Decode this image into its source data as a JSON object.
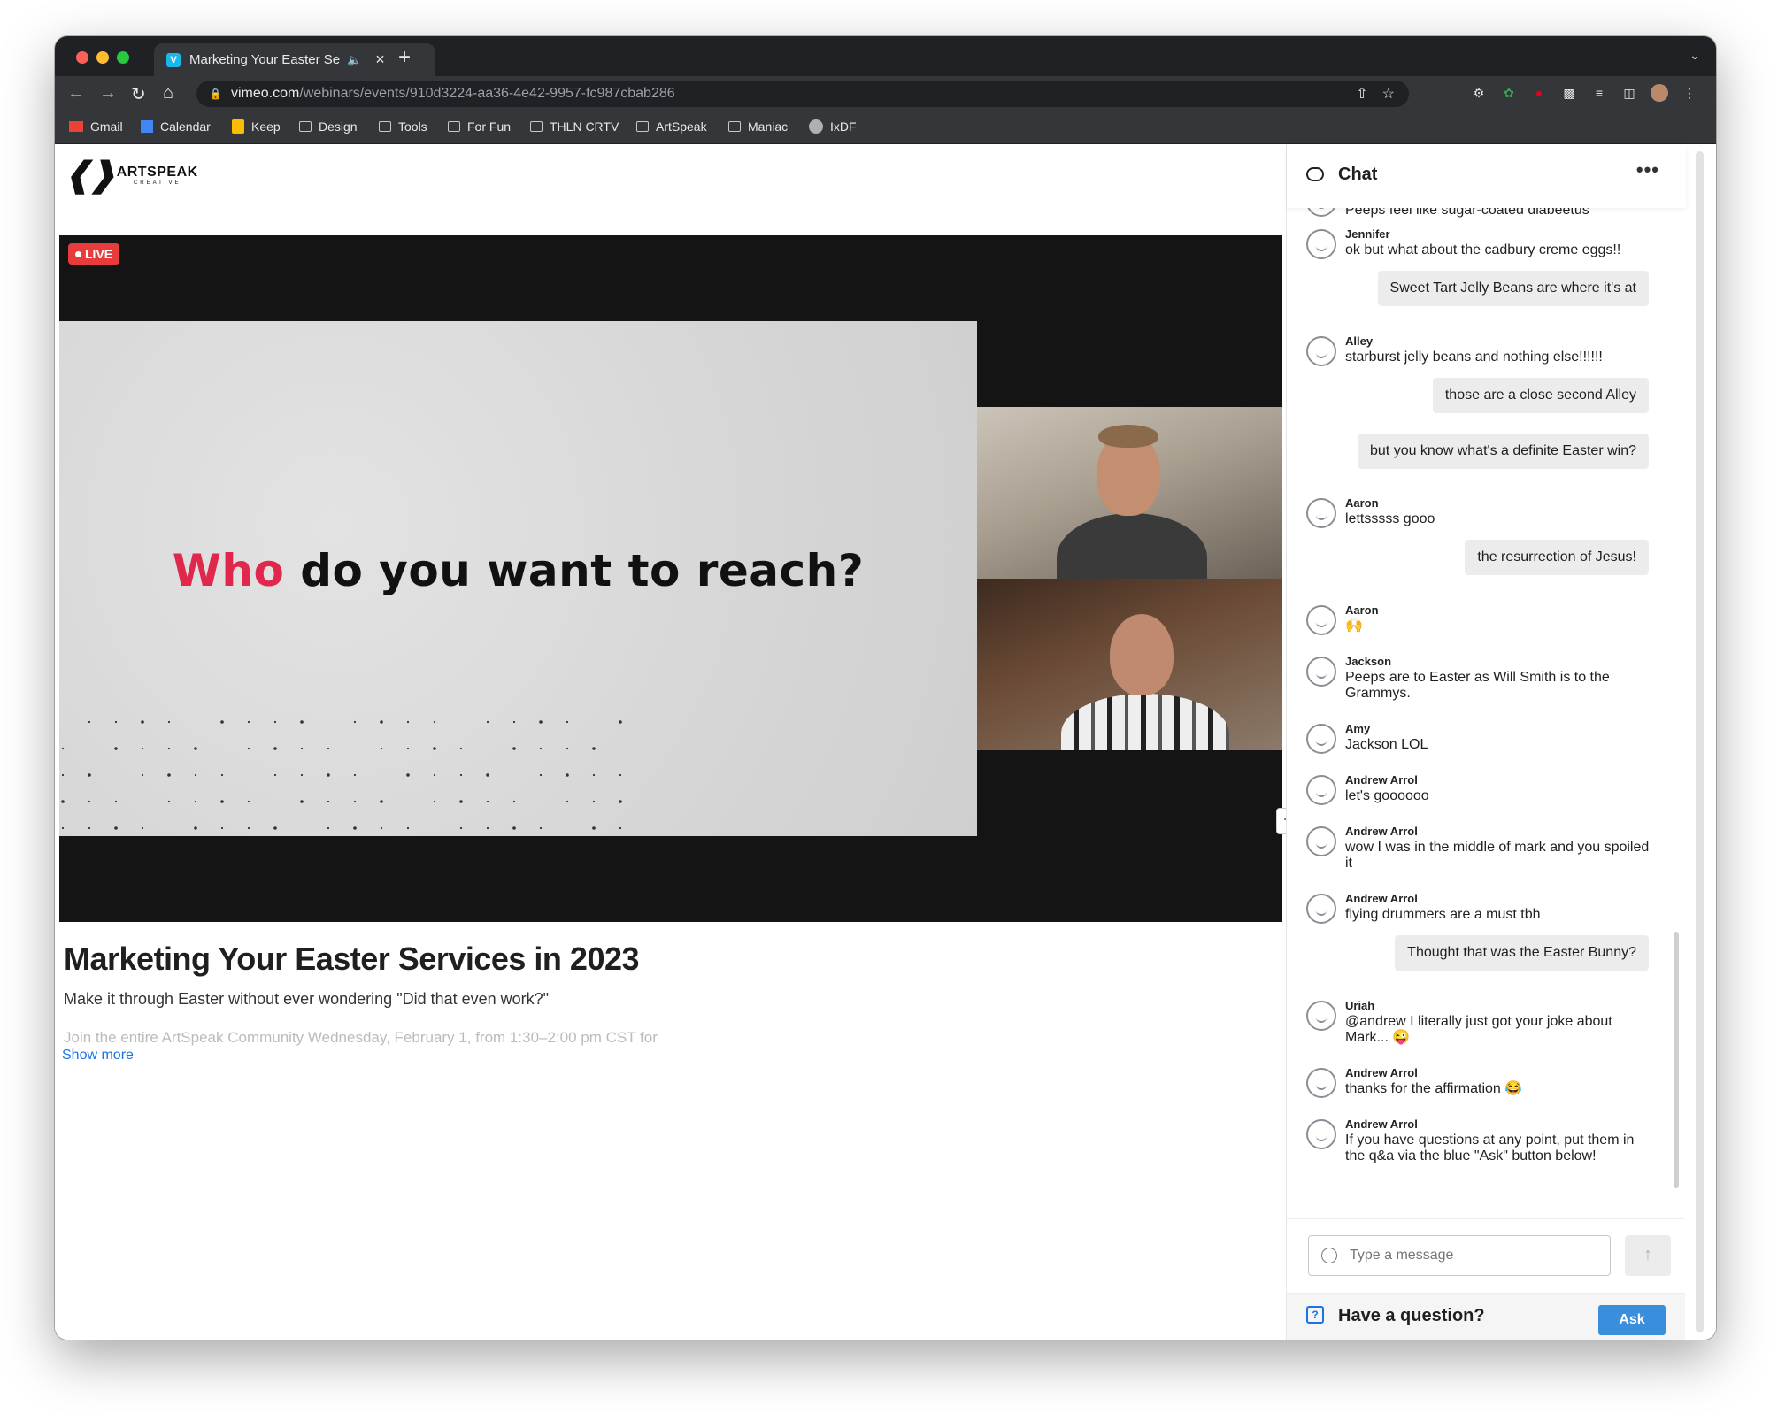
{
  "browser": {
    "tab_title": "Marketing Your Easter Ser…",
    "tab_favicon": "V",
    "tab_audio_icon": "speaker-muted-icon",
    "new_tab_icon": "+",
    "url_host": "vimeo.com",
    "url_path": "/webinars/events/910d3224-aa36-4e42-9957-fc987cbab286",
    "bookmarks": [
      {
        "label": "Gmail",
        "icon": "gmail-icon"
      },
      {
        "label": "Calendar",
        "icon": "calendar-icon"
      },
      {
        "label": "Keep",
        "icon": "keep-icon"
      },
      {
        "label": "Design",
        "icon": "folder-icon"
      },
      {
        "label": "Tools",
        "icon": "folder-icon"
      },
      {
        "label": "For Fun",
        "icon": "folder-icon"
      },
      {
        "label": "THLN CRTV",
        "icon": "folder-icon"
      },
      {
        "label": "ArtSpeak",
        "icon": "folder-icon"
      },
      {
        "label": "Maniac",
        "icon": "folder-icon"
      },
      {
        "label": "IxDF",
        "icon": "ixdf-icon"
      }
    ]
  },
  "logo": {
    "name": "ARTSPEAK",
    "sub": "CREATIVE"
  },
  "player": {
    "live_label": "LIVE",
    "slide_highlight": "Who",
    "slide_rest": " do you want to reach?"
  },
  "event": {
    "title": "Marketing Your Easter Services in 2023",
    "subtitle": "Make it through Easter without ever wondering \"Did that even work?\"",
    "description_preview": "Join the entire ArtSpeak Community Wednesday, February 1, from 1:30–2:00 pm CST for",
    "show_more": "Show more"
  },
  "chat": {
    "title": "Chat",
    "more_label": "•••",
    "partial_top": "Peeps feel like sugar-coated diabeetus",
    "messages": [
      {
        "name": "Jennifer",
        "text": "ok but what about the cadbury creme eggs!!"
      },
      {
        "mine": "Sweet Tart Jelly Beans are where it's at"
      },
      {
        "name": "Alley",
        "text": "starburst jelly beans and nothing else!!!!!!"
      },
      {
        "mine": "those are a close second Alley"
      },
      {
        "mine": "but you know what's a definite Easter win?"
      },
      {
        "name": "Aaron",
        "text": "lettsssss gooo"
      },
      {
        "mine": "the resurrection of Jesus!"
      },
      {
        "name": "Aaron",
        "text": "🙌"
      },
      {
        "name": "Jackson",
        "text": "Peeps are to Easter as Will Smith is to the Grammys."
      },
      {
        "name": "Amy",
        "text": "Jackson LOL"
      },
      {
        "name": "Andrew Arrol",
        "text": "let's goooooo"
      },
      {
        "name": "Andrew Arrol",
        "text": "wow I was in the middle of mark and you spoiled it"
      },
      {
        "name": "Andrew Arrol",
        "text": "flying drummers are a must tbh"
      },
      {
        "mine": "Thought that was the Easter Bunny?"
      },
      {
        "name": "Uriah",
        "text": "@andrew I literally just got your joke about Mark... 😜"
      },
      {
        "name": "Andrew Arrol",
        "text": "thanks for the affirmation 😂"
      },
      {
        "name": "Andrew Arrol",
        "text": "If you have questions at any point, put them in the q&a via the blue \"Ask\" button below!"
      }
    ],
    "input_placeholder": "Type a message",
    "question_label": "Have a question?",
    "ask_label": "Ask"
  }
}
